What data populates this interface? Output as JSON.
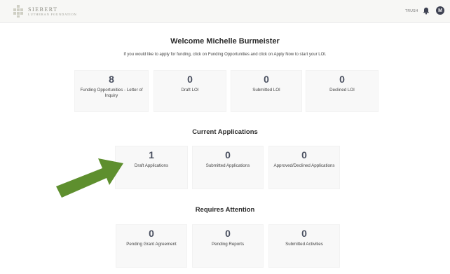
{
  "header": {
    "logo_title": "SIEBERT",
    "logo_subtitle": "LUTHERAN FOUNDATION",
    "user_name": "TRUSH",
    "avatar_initial": "M",
    "bell_icon": "bell-icon"
  },
  "welcome": {
    "title": "Welcome Michelle Burmeister",
    "instructions": "If you would like to apply for funding, click on Funding Opportunities and click on Apply Now to start your LOI."
  },
  "loi_stats": [
    {
      "value": "8",
      "label": "Funding Opportunities - Letter of Inquiry"
    },
    {
      "value": "0",
      "label": "Draft LOI"
    },
    {
      "value": "0",
      "label": "Submitted LOI"
    },
    {
      "value": "0",
      "label": "Declined LOI"
    }
  ],
  "current_applications": {
    "title": "Current Applications",
    "stats": [
      {
        "value": "1",
        "label": "Draft Applications"
      },
      {
        "value": "0",
        "label": "Submitted Applications"
      },
      {
        "value": "0",
        "label": "Approved/Declined Applications"
      }
    ]
  },
  "requires_attention": {
    "title": "Requires Attention",
    "stats": [
      {
        "value": "0",
        "label": "Pending Grant Agreement"
      },
      {
        "value": "0",
        "label": "Pending Reports"
      },
      {
        "value": "0",
        "label": "Submitted Activities"
      }
    ]
  },
  "colors": {
    "arrow": "#5e8f2e",
    "stat_number": "#4a5060",
    "card_background": "#f8f8f8"
  }
}
